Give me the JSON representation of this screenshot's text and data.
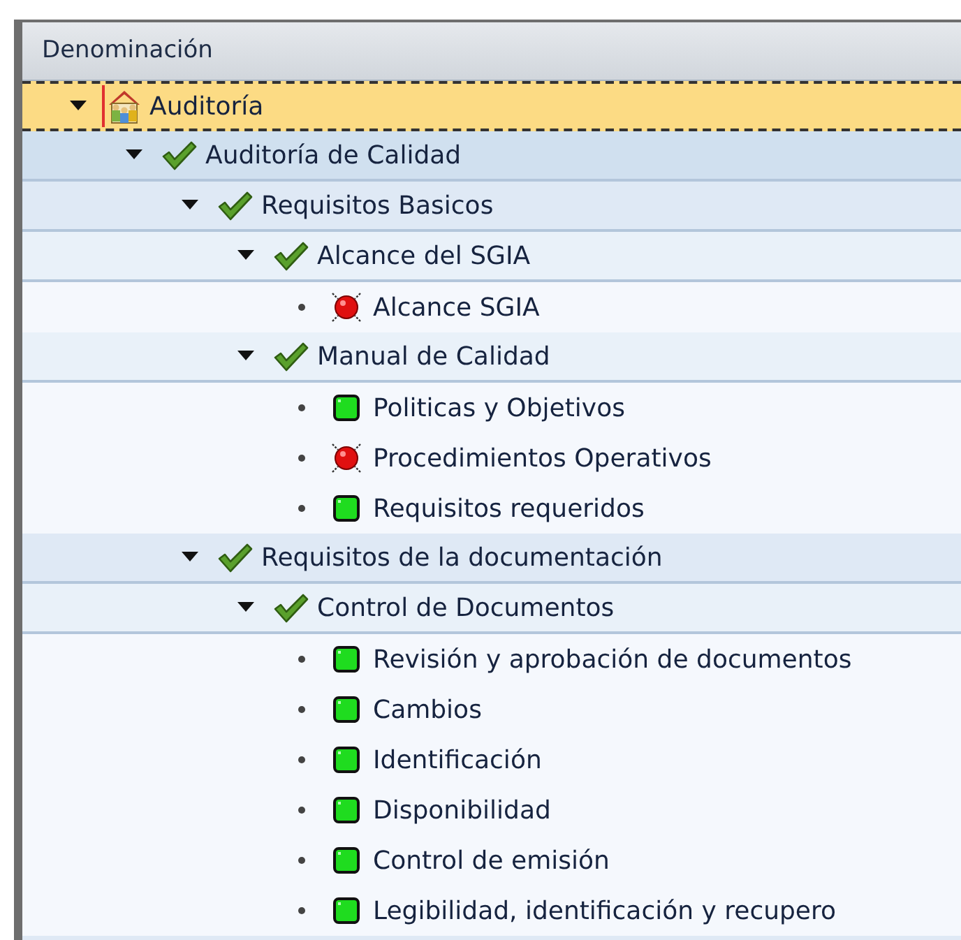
{
  "column_header": "Denominación",
  "tree": [
    {
      "label": "Auditoría",
      "kind": "root",
      "expanded": true,
      "selected": true,
      "children": [
        {
          "label": "Auditoría de Calidad",
          "kind": "node",
          "expanded": true,
          "selected": false,
          "children": [
            {
              "label": "Requisitos Basicos",
              "kind": "node",
              "expanded": true,
              "selected": false,
              "children": [
                {
                  "label": "Alcance del SGIA",
                  "kind": "node",
                  "expanded": true,
                  "selected": false,
                  "children": [
                    {
                      "label": "Alcance SGIA",
                      "kind": "failed",
                      "selected": false
                    }
                  ]
                },
                {
                  "label": "Manual de Calidad",
                  "kind": "node",
                  "expanded": true,
                  "selected": false,
                  "children": [
                    {
                      "label": "Politicas y Objetivos",
                      "kind": "passed",
                      "selected": false
                    },
                    {
                      "label": "Procedimientos Operativos",
                      "kind": "failed",
                      "selected": false
                    },
                    {
                      "label": "Requisitos requeridos",
                      "kind": "passed",
                      "selected": false
                    }
                  ]
                }
              ]
            },
            {
              "label": "Requisitos de la documentación",
              "kind": "node",
              "expanded": true,
              "selected": false,
              "children": [
                {
                  "label": "Control de Documentos",
                  "kind": "node",
                  "expanded": true,
                  "selected": false,
                  "children": [
                    {
                      "label": "Revisión y aprobación de documentos",
                      "kind": "passed",
                      "selected": false
                    },
                    {
                      "label": "Cambios",
                      "kind": "passed",
                      "selected": false
                    },
                    {
                      "label": "Identificación",
                      "kind": "passed",
                      "selected": false
                    },
                    {
                      "label": "Disponibilidad",
                      "kind": "passed",
                      "selected": false
                    },
                    {
                      "label": "Control de emisión",
                      "kind": "passed",
                      "selected": false
                    },
                    {
                      "label": "Legibilidad, identificación y recupero",
                      "kind": "passed",
                      "selected": false
                    }
                  ]
                }
              ]
            }
          ]
        }
      ]
    }
  ]
}
